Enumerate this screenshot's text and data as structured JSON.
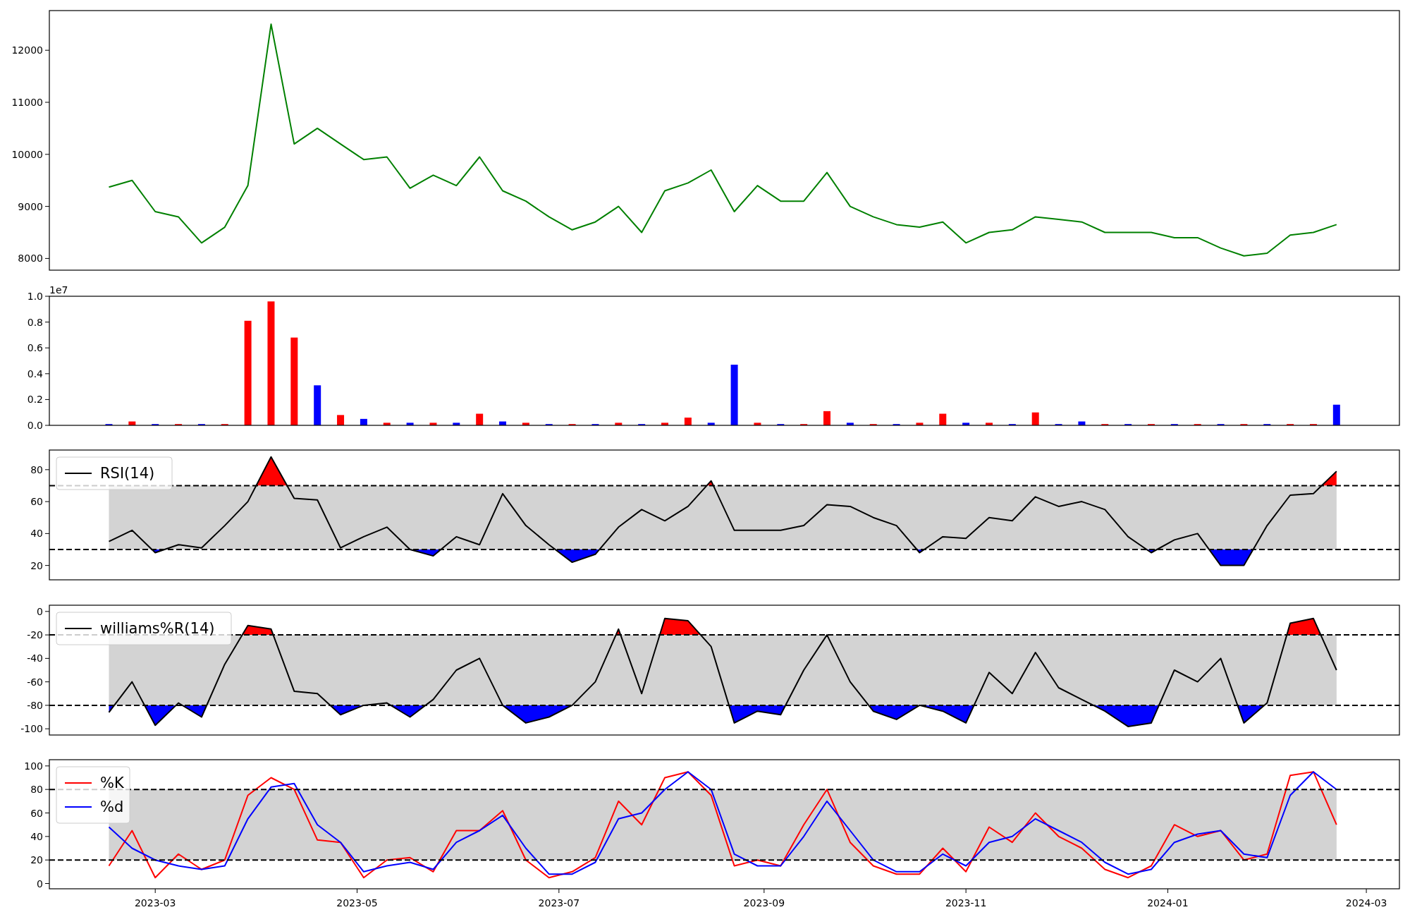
{
  "panels": [
    {
      "chart_data": {
        "type": "line",
        "x": [
          "2023-02-15",
          "2023-02-22",
          "2023-03-01",
          "2023-03-08",
          "2023-03-15",
          "2023-03-22",
          "2023-03-29",
          "2023-04-05",
          "2023-04-12",
          "2023-04-19",
          "2023-04-26",
          "2023-05-03",
          "2023-05-10",
          "2023-05-17",
          "2023-05-24",
          "2023-05-31",
          "2023-06-07",
          "2023-06-14",
          "2023-06-21",
          "2023-06-28",
          "2023-07-05",
          "2023-07-12",
          "2023-07-19",
          "2023-07-26",
          "2023-08-02",
          "2023-08-09",
          "2023-08-16",
          "2023-08-23",
          "2023-08-30",
          "2023-09-06",
          "2023-09-13",
          "2023-09-20",
          "2023-09-27",
          "2023-10-04",
          "2023-10-11",
          "2023-10-18",
          "2023-10-25",
          "2023-11-01",
          "2023-11-08",
          "2023-11-15",
          "2023-11-22",
          "2023-11-29",
          "2023-12-06",
          "2023-12-13",
          "2023-12-20",
          "2023-12-27",
          "2024-01-03",
          "2024-01-10",
          "2024-01-17",
          "2024-01-24",
          "2024-01-31",
          "2024-02-07",
          "2024-02-14",
          "2024-02-21"
        ],
        "series": [
          {
            "color": "#008000",
            "values": [
              9370,
              9500,
              8900,
              8800,
              8300,
              8600,
              9400,
              12500,
              10200,
              10500,
              10200,
              9900,
              9950,
              9350,
              9600,
              9400,
              9950,
              9300,
              9100,
              8800,
              8550,
              8700,
              9000,
              8500,
              9300,
              9450,
              9700,
              8900,
              9400,
              9100,
              9100,
              9650,
              9000,
              8800,
              8650,
              8600,
              8700,
              8300,
              8500,
              8550,
              8800,
              8750,
              8700,
              8500,
              8500,
              8500,
              8400,
              8400,
              8200,
              8050,
              8100,
              8450,
              8500,
              8650
            ]
          }
        ],
        "xlim": [
          "2023-01-28",
          "2024-03-11"
        ],
        "ylim": [
          7775,
          12762
        ],
        "yticks": [
          8000,
          9000,
          10000,
          11000,
          12000
        ]
      }
    },
    {
      "chart_data": {
        "type": "bar",
        "x": [
          "2023-02-15",
          "2023-02-22",
          "2023-03-01",
          "2023-03-08",
          "2023-03-15",
          "2023-03-22",
          "2023-03-29",
          "2023-04-05",
          "2023-04-12",
          "2023-04-19",
          "2023-04-26",
          "2023-05-03",
          "2023-05-10",
          "2023-05-17",
          "2023-05-24",
          "2023-05-31",
          "2023-06-07",
          "2023-06-14",
          "2023-06-21",
          "2023-06-28",
          "2023-07-05",
          "2023-07-12",
          "2023-07-19",
          "2023-07-26",
          "2023-08-02",
          "2023-08-09",
          "2023-08-16",
          "2023-08-23",
          "2023-08-30",
          "2023-09-06",
          "2023-09-13",
          "2023-09-20",
          "2023-09-27",
          "2023-10-04",
          "2023-10-11",
          "2023-10-18",
          "2023-10-25",
          "2023-11-01",
          "2023-11-08",
          "2023-11-15",
          "2023-11-22",
          "2023-11-29",
          "2023-12-06",
          "2023-12-13",
          "2023-12-20",
          "2023-12-27",
          "2024-01-03",
          "2024-01-10",
          "2024-01-17",
          "2024-01-24",
          "2024-01-31",
          "2024-02-07",
          "2024-02-14",
          "2024-02-21"
        ],
        "series": [
          {
            "color": "#ff0000",
            "values": [
              null,
              0.03,
              null,
              0.01,
              null,
              0.01,
              0.81,
              0.96,
              0.68,
              null,
              0.08,
              null,
              0.02,
              null,
              0.02,
              null,
              0.09,
              null,
              0.02,
              null,
              0.01,
              null,
              0.02,
              null,
              0.02,
              0.06,
              null,
              null,
              0.02,
              null,
              0.01,
              0.11,
              null,
              0.01,
              null,
              0.02,
              0.09,
              null,
              0.02,
              null,
              0.1,
              null,
              null,
              0.01,
              null,
              0.01,
              null,
              0.01,
              null,
              0.01,
              null,
              0.01,
              0.01,
              null
            ]
          },
          {
            "color": "#0000ff",
            "values": [
              0.01,
              null,
              0.01,
              null,
              0.01,
              null,
              null,
              null,
              null,
              0.31,
              null,
              0.05,
              null,
              0.02,
              null,
              0.02,
              null,
              0.03,
              null,
              0.01,
              null,
              0.01,
              null,
              0.01,
              null,
              null,
              0.02,
              0.47,
              null,
              0.01,
              null,
              null,
              0.02,
              null,
              0.01,
              null,
              null,
              0.02,
              null,
              0.01,
              null,
              0.01,
              0.03,
              null,
              0.01,
              null,
              0.01,
              null,
              0.01,
              null,
              0.01,
              null,
              null,
              0.16
            ]
          }
        ],
        "xlim": [
          "2023-01-28",
          "2024-03-11"
        ],
        "ylim": [
          0,
          1.0
        ],
        "yticks": [
          {
            "value": 0,
            "label": "0.0"
          },
          {
            "value": 0.2,
            "label": "0.2"
          },
          {
            "value": 0.4,
            "label": "0.4"
          },
          {
            "value": 0.6,
            "label": "0.6"
          },
          {
            "value": 0.8,
            "label": "0.8"
          },
          {
            "value": 1.0,
            "label": "1.0"
          }
        ],
        "annotations": [
          {
            "text": "1e7"
          }
        ]
      }
    },
    {
      "chart_data": {
        "type": "line",
        "x": [
          "2023-02-15",
          "2023-02-22",
          "2023-03-01",
          "2023-03-08",
          "2023-03-15",
          "2023-03-22",
          "2023-03-29",
          "2023-04-05",
          "2023-04-12",
          "2023-04-19",
          "2023-04-26",
          "2023-05-03",
          "2023-05-10",
          "2023-05-17",
          "2023-05-24",
          "2023-05-31",
          "2023-06-07",
          "2023-06-14",
          "2023-06-21",
          "2023-06-28",
          "2023-07-05",
          "2023-07-12",
          "2023-07-19",
          "2023-07-26",
          "2023-08-02",
          "2023-08-09",
          "2023-08-16",
          "2023-08-23",
          "2023-08-30",
          "2023-09-06",
          "2023-09-13",
          "2023-09-20",
          "2023-09-27",
          "2023-10-04",
          "2023-10-11",
          "2023-10-18",
          "2023-10-25",
          "2023-11-01",
          "2023-11-08",
          "2023-11-15",
          "2023-11-22",
          "2023-11-29",
          "2023-12-06",
          "2023-12-13",
          "2023-12-20",
          "2023-12-27",
          "2024-01-03",
          "2024-01-10",
          "2024-01-17",
          "2024-01-24",
          "2024-01-31",
          "2024-02-07",
          "2024-02-14",
          "2024-02-21"
        ],
        "series": [
          {
            "name": "RSI(14)",
            "color": "#000000",
            "values": [
              35,
              42,
              28,
              33,
              31,
              45,
              60,
              88,
              62,
              61,
              31,
              38,
              44,
              30,
              26,
              38,
              33,
              65,
              45,
              33,
              22,
              27,
              44,
              55,
              48,
              57,
              73,
              42,
              42,
              42,
              45,
              58,
              57,
              50,
              45,
              28,
              38,
              37,
              50,
              48,
              63,
              57,
              60,
              55,
              38,
              28,
              36,
              40,
              20,
              20,
              45,
              64,
              65,
              79
            ]
          }
        ],
        "xlim": [
          "2023-01-28",
          "2024-03-11"
        ],
        "ylim": [
          11,
          92.3
        ],
        "yticks": [
          20,
          40,
          60,
          80
        ],
        "legend": true,
        "bands": [
          {
            "axis": "y",
            "from": 30,
            "to": 70
          }
        ],
        "ref_lines": [
          {
            "axis": "y",
            "value": 70
          },
          {
            "axis": "y",
            "value": 30
          }
        ]
      }
    },
    {
      "chart_data": {
        "type": "line",
        "x": [
          "2023-02-15",
          "2023-02-22",
          "2023-03-01",
          "2023-03-08",
          "2023-03-15",
          "2023-03-22",
          "2023-03-29",
          "2023-04-05",
          "2023-04-12",
          "2023-04-19",
          "2023-04-26",
          "2023-05-03",
          "2023-05-10",
          "2023-05-17",
          "2023-05-24",
          "2023-05-31",
          "2023-06-07",
          "2023-06-14",
          "2023-06-21",
          "2023-06-28",
          "2023-07-05",
          "2023-07-12",
          "2023-07-19",
          "2023-07-26",
          "2023-08-02",
          "2023-08-09",
          "2023-08-16",
          "2023-08-23",
          "2023-08-30",
          "2023-09-06",
          "2023-09-13",
          "2023-09-20",
          "2023-09-27",
          "2023-10-04",
          "2023-10-11",
          "2023-10-18",
          "2023-10-25",
          "2023-11-01",
          "2023-11-08",
          "2023-11-15",
          "2023-11-22",
          "2023-11-29",
          "2023-12-06",
          "2023-12-13",
          "2023-12-20",
          "2023-12-27",
          "2024-01-03",
          "2024-01-10",
          "2024-01-17",
          "2024-01-24",
          "2024-01-31",
          "2024-02-07",
          "2024-02-14",
          "2024-02-21"
        ],
        "series": [
          {
            "name": "williams%R(14)",
            "color": "#000000",
            "values": [
              -86,
              -60,
              -97,
              -78,
              -90,
              -45,
              -12,
              -15,
              -68,
              -70,
              -88,
              -80,
              -78,
              -90,
              -75,
              -50,
              -40,
              -80,
              -95,
              -90,
              -80,
              -60,
              -15,
              -70,
              -6,
              -8,
              -30,
              -95,
              -85,
              -88,
              -50,
              -20,
              -60,
              -85,
              -92,
              -80,
              -85,
              -95,
              -52,
              -70,
              -35,
              -65,
              -75,
              -85,
              -98,
              -95,
              -50,
              -60,
              -40,
              -95,
              -78,
              -10,
              -6,
              -50
            ]
          }
        ],
        "xlim": [
          "2023-01-28",
          "2024-03-11"
        ],
        "ylim": [
          -105.3,
          5.3
        ],
        "yticks": [
          -100,
          -80,
          -60,
          -40,
          -20,
          0
        ],
        "legend": true,
        "bands": [
          {
            "axis": "y",
            "from": -80,
            "to": -20
          }
        ],
        "ref_lines": [
          {
            "axis": "y",
            "value": -20
          },
          {
            "axis": "y",
            "value": -80
          }
        ]
      }
    },
    {
      "chart_data": {
        "type": "line",
        "x": [
          "2023-02-15",
          "2023-02-22",
          "2023-03-01",
          "2023-03-08",
          "2023-03-15",
          "2023-03-22",
          "2023-03-29",
          "2023-04-05",
          "2023-04-12",
          "2023-04-19",
          "2023-04-26",
          "2023-05-03",
          "2023-05-10",
          "2023-05-17",
          "2023-05-24",
          "2023-05-31",
          "2023-06-07",
          "2023-06-14",
          "2023-06-21",
          "2023-06-28",
          "2023-07-05",
          "2023-07-12",
          "2023-07-19",
          "2023-07-26",
          "2023-08-02",
          "2023-08-09",
          "2023-08-16",
          "2023-08-23",
          "2023-08-30",
          "2023-09-06",
          "2023-09-13",
          "2023-09-20",
          "2023-09-27",
          "2023-10-04",
          "2023-10-11",
          "2023-10-18",
          "2023-10-25",
          "2023-11-01",
          "2023-11-08",
          "2023-11-15",
          "2023-11-22",
          "2023-11-29",
          "2023-12-06",
          "2023-12-13",
          "2023-12-20",
          "2023-12-27",
          "2024-01-03",
          "2024-01-10",
          "2024-01-17",
          "2024-01-24",
          "2024-01-31",
          "2024-02-07",
          "2024-02-14",
          "2024-02-21"
        ],
        "series": [
          {
            "name": "%K",
            "color": "#ff0000",
            "values": [
              15,
              45,
              5,
              25,
              12,
              20,
              75,
              90,
              80,
              37,
              35,
              5,
              20,
              22,
              10,
              45,
              45,
              62,
              20,
              5,
              10,
              22,
              70,
              50,
              90,
              95,
              75,
              15,
              20,
              15,
              50,
              80,
              35,
              15,
              8,
              8,
              30,
              10,
              48,
              35,
              60,
              40,
              30,
              12,
              5,
              15,
              50,
              40,
              45,
              20,
              25,
              92,
              95,
              50
            ]
          },
          {
            "name": "%d",
            "color": "#0000ff",
            "values": [
              48,
              30,
              20,
              15,
              12,
              15,
              55,
              82,
              85,
              50,
              35,
              10,
              15,
              18,
              12,
              35,
              45,
              58,
              30,
              8,
              8,
              18,
              55,
              60,
              80,
              95,
              80,
              25,
              15,
              15,
              40,
              70,
              45,
              20,
              10,
              10,
              25,
              15,
              35,
              40,
              55,
              45,
              35,
              18,
              8,
              12,
              35,
              42,
              45,
              25,
              22,
              75,
              95,
              80
            ]
          }
        ],
        "xlim": [
          "2023-01-28",
          "2024-03-11"
        ],
        "ylim": [
          -4.5,
          105.3
        ],
        "yticks": [
          0,
          20,
          40,
          60,
          80,
          100
        ],
        "xticks": [
          {
            "value": "2023-03-01",
            "label": "2023-03"
          },
          {
            "value": "2023-05-01",
            "label": "2023-05"
          },
          {
            "value": "2023-07-01",
            "label": "2023-07"
          },
          {
            "value": "2023-09-01",
            "label": "2023-09"
          },
          {
            "value": "2023-11-01",
            "label": "2023-11"
          },
          {
            "value": "2024-01-01",
            "label": "2024-01"
          },
          {
            "value": "2024-03-01",
            "label": "2024-03"
          }
        ],
        "legend": true,
        "bands": [
          {
            "axis": "y",
            "from": 20,
            "to": 80
          }
        ],
        "ref_lines": [
          {
            "axis": "y",
            "value": 80
          },
          {
            "axis": "y",
            "value": 20
          }
        ]
      }
    }
  ]
}
